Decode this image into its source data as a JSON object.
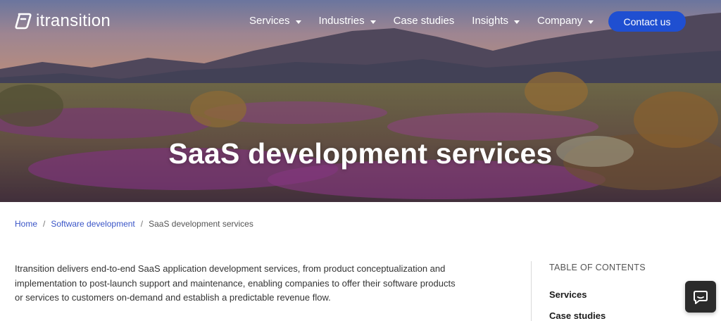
{
  "brand": {
    "name": "itransition",
    "logo_icon": "itransition-logo-icon"
  },
  "nav": {
    "items": [
      {
        "label": "Services",
        "has_dropdown": true
      },
      {
        "label": "Industries",
        "has_dropdown": true
      },
      {
        "label": "Case studies",
        "has_dropdown": false
      },
      {
        "label": "Insights",
        "has_dropdown": true
      },
      {
        "label": "Company",
        "has_dropdown": true
      }
    ],
    "contact_label": "Contact us"
  },
  "hero": {
    "title": "SaaS development services"
  },
  "breadcrumb": {
    "items": [
      {
        "label": "Home"
      },
      {
        "label": "Software development"
      }
    ],
    "separator": "/",
    "current": "SaaS development services"
  },
  "intro": {
    "text": "Itransition delivers end-to-end SaaS application development services, from product conceptualization and implementation to post-launch support and maintenance, enabling companies to offer their software products or services to customers on-demand and establish a predictable revenue flow."
  },
  "toc": {
    "title": "TABLE OF CONTENTS",
    "items": [
      {
        "label": "Services"
      },
      {
        "label": "Case studies"
      }
    ]
  },
  "chat": {
    "icon": "chat-bubble-icon"
  },
  "colors": {
    "accent": "#1f4fd1",
    "link": "#3a55c7",
    "text": "#333333",
    "chat_bg": "#2b2b2b"
  }
}
